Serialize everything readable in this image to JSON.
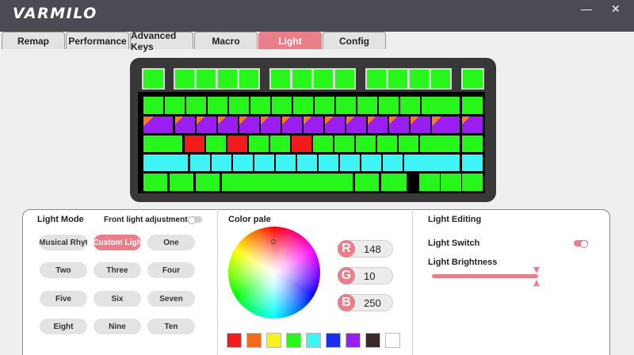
{
  "app": {
    "logo": "VARMILO",
    "minimize_glyph": "—",
    "close_glyph": "✕"
  },
  "tabs": [
    {
      "label": "Remap"
    },
    {
      "label": "Performance"
    },
    {
      "label": "Advanced Keys"
    },
    {
      "label": "Macro"
    },
    {
      "label": "Light",
      "active": true
    },
    {
      "label": "Config"
    }
  ],
  "colors": {
    "accent": "#ea7f8a",
    "key_green": "#27f61a",
    "key_red": "#f21b1b",
    "key_cyan": "#3ef4f4",
    "key_purple": "#9a1ef2"
  },
  "light_mode": {
    "title": "Light Mode",
    "front_light_label": "Front light adjustment",
    "front_light_on": false,
    "modes": [
      "Musical Rhyt",
      "Custom Ligh",
      "One",
      "Two",
      "Three",
      "Four",
      "Five",
      "Six",
      "Seven",
      "Eight",
      "Nine",
      "Ten"
    ],
    "selected": "Custom Ligh"
  },
  "color_pale": {
    "title": "Color pale",
    "r_label": "R",
    "g_label": "G",
    "b_label": "B",
    "r": "148",
    "g": "10",
    "b": "250",
    "swatches": [
      "#f21b1b",
      "#f26a1b",
      "#f7f21b",
      "#27f61a",
      "#3ef4f4",
      "#1b2ef2",
      "#9a1ef2",
      "#3a2b2b",
      "#ffffff"
    ]
  },
  "light_editing": {
    "title": "Light Editing",
    "switch_label": "Light Switch",
    "switch_on": true,
    "brightness_label": "Light Brightness",
    "brightness": 1.0
  }
}
